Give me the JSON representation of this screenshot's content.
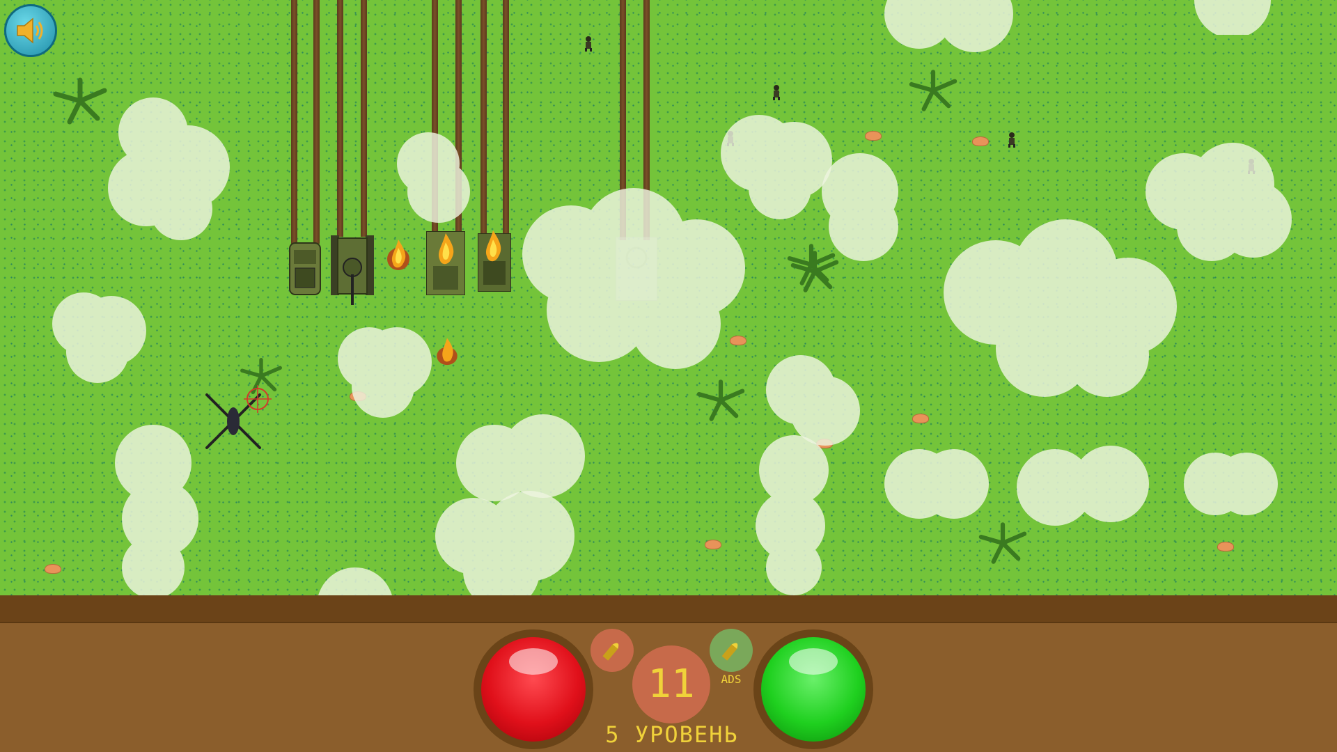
{
  "game": {
    "sound_icon": "speaker-icon",
    "fire_button_icon": "red-fire-button",
    "go_button_icon": "green-action-button",
    "ammo_icon": "bullet-icon",
    "score": "11",
    "ads_label": "ADS",
    "level_label": "5 УРОВЕНЬ"
  },
  "colors": {
    "grass": "#74c43a",
    "panel": "#8b5e2c",
    "panel_top": "#6b4318",
    "red_button": "#e0101a",
    "green_button": "#1fd01f",
    "accent_text": "#f0d23a",
    "score_circle": "#c76a4a",
    "ammo_red": "#c76a4a",
    "ammo_green": "#7aa85a"
  }
}
